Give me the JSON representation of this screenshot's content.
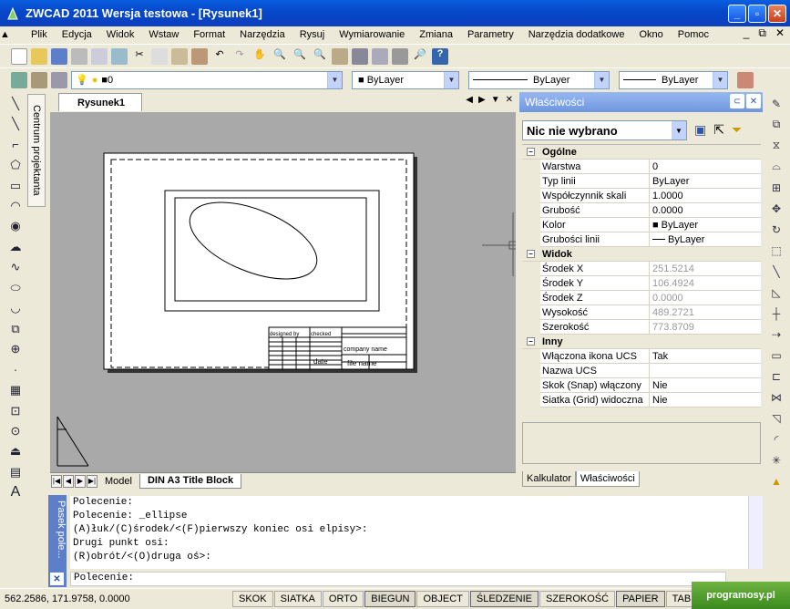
{
  "window": {
    "title": "ZWCAD 2011 Wersja testowa - [Rysunek1]"
  },
  "menu": {
    "items": [
      "Plik",
      "Edycja",
      "Widok",
      "Wstaw",
      "Format",
      "Narzędzia",
      "Rysuj",
      "Wymiarowanie",
      "Zmiana",
      "Parametry",
      "Narzędzia dodatkowe",
      "Okno",
      "Pomoc"
    ]
  },
  "layers": {
    "current_layer": "0",
    "color": "ByLayer",
    "linetype": "ByLayer",
    "lineweight": "ByLayer"
  },
  "left_panel": {
    "tab": "Centrum projektanta"
  },
  "document": {
    "tab": "Rysunek1"
  },
  "layout_tabs": {
    "model": "Model",
    "layout": "DIN A3 Title Block"
  },
  "titleblock": {
    "designed_by": "designed by",
    "checked": "checked",
    "company": "company name",
    "date": "date",
    "file": "file name"
  },
  "properties": {
    "title": "Właściwości",
    "selection": "Nic nie wybrano",
    "general_cat": "Ogólne",
    "layer_k": "Warstwa",
    "layer_v": "0",
    "linetype_k": "Typ linii",
    "linetype_v": "ByLayer",
    "ltscale_k": "Współczynnik skali",
    "ltscale_v": "1.0000",
    "thickness_k": "Grubość",
    "thickness_v": "0.0000",
    "color_k": "Kolor",
    "color_v": "ByLayer",
    "lweight_k": "Grubości linii",
    "lweight_v": "ByLayer",
    "view_cat": "Widok",
    "cx_k": "Środek X",
    "cx_v": "251.5214",
    "cy_k": "Środek Y",
    "cy_v": "106.4924",
    "cz_k": "Środek Z",
    "cz_v": "0.0000",
    "h_k": "Wysokość",
    "h_v": "489.2721",
    "w_k": "Szerokość",
    "w_v": "773.8709",
    "misc_cat": "Inny",
    "ucs_k": "Włączona ikona UCS",
    "ucs_v": "Tak",
    "ucsname_k": "Nazwa UCS",
    "ucsname_v": "",
    "snap_k": "Skok (Snap) włączony",
    "snap_v": "Nie",
    "grid_k": "Siatka (Grid) widoczna",
    "grid_v": "Nie",
    "tab_calc": "Kalkulator",
    "tab_props": "Właściwości"
  },
  "command": {
    "panel_label": "Pasek pole...",
    "history": [
      "Polecenie:",
      "Polecenie: _ellipse",
      "(A)łuk/(C)środek/<(F)pierwszy koniec osi elpisy>:",
      "Drugi punkt osi:",
      "(R)obrót/<(O)druga oś>:"
    ],
    "prompt": "Polecenie:"
  },
  "status": {
    "coords": "562.2586,  171.9758,  0.0000",
    "buttons": [
      "SKOK",
      "SIATKA",
      "ORTO",
      "BIEGUN",
      "OBJECT",
      "ŚLEDZENIE",
      "SZEROKOŚĆ",
      "PAPIER",
      "TABLET"
    ],
    "watermark": "programosy.pl"
  }
}
